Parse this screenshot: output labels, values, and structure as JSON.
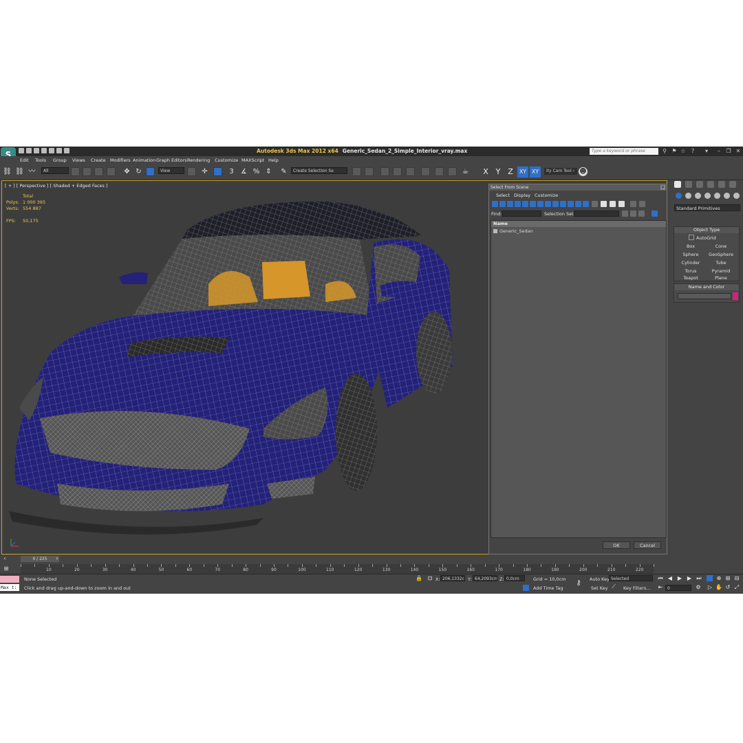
{
  "window": {
    "logo_letter": "S",
    "app_title": "Autodesk 3ds Max  2012 x64",
    "file_name": "Generic_Sedan_2_Simple_Interior_vray.max",
    "search_placeholder": "Type a keyword or phrase"
  },
  "menu": [
    "Edit",
    "Tools",
    "Group",
    "Views",
    "Create",
    "Modifiers",
    "Animation",
    "Graph Editors",
    "Rendering",
    "Customize",
    "MAXScript",
    "Help"
  ],
  "toolbar": {
    "selection_filter": "All",
    "ref_coord": "View",
    "selection_set": "Create Selection Se",
    "axis_x": "X",
    "axis_y": "Y",
    "axis_z": "Z",
    "axis_xy": "XY",
    "axis_xy2": "XY",
    "cam_tool": "ity Cam Tool ‹"
  },
  "viewport": {
    "label": "[ + ] [ Perspective ] [ Shaded + Edged Faces ]",
    "stats": {
      "total_label": "Total",
      "polys_label": "Polys:",
      "polys_value": "1 000 395",
      "verts_label": "Verts:",
      "verts_value": "554 887",
      "fps_label": "FPS:",
      "fps_value": "50,175"
    }
  },
  "select_dialog": {
    "title": "Select From Scene",
    "menu": [
      "Select",
      "Display",
      "Customize"
    ],
    "find_label": "Find:",
    "selection_set_label": "Selection Set:",
    "column_name": "Name",
    "items": [
      "Generic_Sedan"
    ],
    "ok": "OK",
    "cancel": "Cancel"
  },
  "command_panel": {
    "category": "Standard Primitives",
    "object_type_title": "Object Type",
    "autogrid": "AutoGrid",
    "primitives": [
      "Box",
      "Cone",
      "Sphere",
      "GeoSphere",
      "Cylinder",
      "Tube",
      "Torus",
      "Pyramid",
      "Teapot",
      "Plane"
    ],
    "name_color_title": "Name and Color",
    "object_color": "#d4217d"
  },
  "timeline": {
    "frame_slider": "0 / 225",
    "ticks": [
      "10",
      "20",
      "30",
      "40",
      "50",
      "60",
      "70",
      "80",
      "90",
      "100",
      "110",
      "120",
      "130",
      "140",
      "150",
      "160",
      "170",
      "180",
      "190",
      "200",
      "210",
      "220"
    ]
  },
  "status": {
    "maxscript_listener": "Max t:",
    "selection": "None Selected",
    "prompt": "Click and drag up-and-down to zoom in and out",
    "x_label": "X:",
    "x_value": "206,1332c",
    "y_label": "Y:",
    "y_value": "64,2093cm",
    "z_label": "Z:",
    "z_value": "0,0cm",
    "grid": "Grid = 10,0cm",
    "add_time_tag": "Add Time Tag",
    "auto_key": "Auto Key",
    "auto_key_mode": "Selected",
    "set_key": "Set Key",
    "key_filters": "Key Filters...",
    "current_frame": "0"
  },
  "colors": {
    "accent_blue": "#2f70c8",
    "active_border": "#c9a227",
    "car_body": "#24217a",
    "seat_orange": "#d6962a"
  }
}
